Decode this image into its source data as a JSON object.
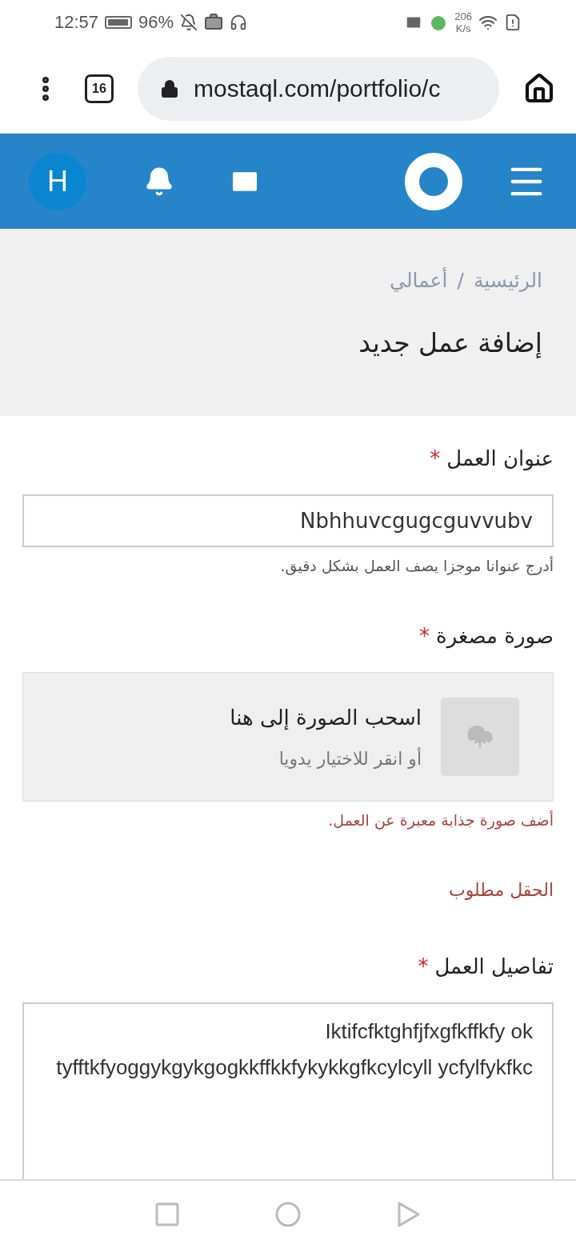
{
  "status_bar": {
    "time": "12:57",
    "battery": "96%",
    "speed_value": "206",
    "speed_unit": "K/s"
  },
  "browser": {
    "tab_count": "16",
    "url": "mostaql.com/portfolio/c"
  },
  "header": {
    "avatar_letter": "H"
  },
  "breadcrumb": {
    "items": [
      {
        "label": "الرئيسية"
      },
      {
        "label": "أعمالي"
      }
    ],
    "separator": "/"
  },
  "page_title": "إضافة عمل جديد",
  "fields": [
    {
      "kind": "text",
      "label": "عنوان العمل",
      "required_mark": "*",
      "value": "Nbhhuvcgugcguvvubv",
      "hint": {
        "text": "أدرج عنوانا موجزا يصف العمل بشكل دقيق.",
        "error": false
      }
    },
    {
      "kind": "upload",
      "label": "صورة مصغرة",
      "required_mark": "*",
      "drop_title": "اسحب الصورة إلى هنا",
      "drop_subtitle": "أو انقر للاختيار يدويا",
      "hint": {
        "text": "أضف صورة جذابة معبرة عن العمل.",
        "error": true
      },
      "error": "الحقل مطلوب"
    },
    {
      "kind": "textarea",
      "label": "تفاصيل العمل",
      "required_mark": "*",
      "value": "Iktifcfktghfjfxgfkffkfy ok tyfftkfyoggykgykgogkkffkkfykykkgfkcylcyll ycfylfykfkc"
    }
  ]
}
